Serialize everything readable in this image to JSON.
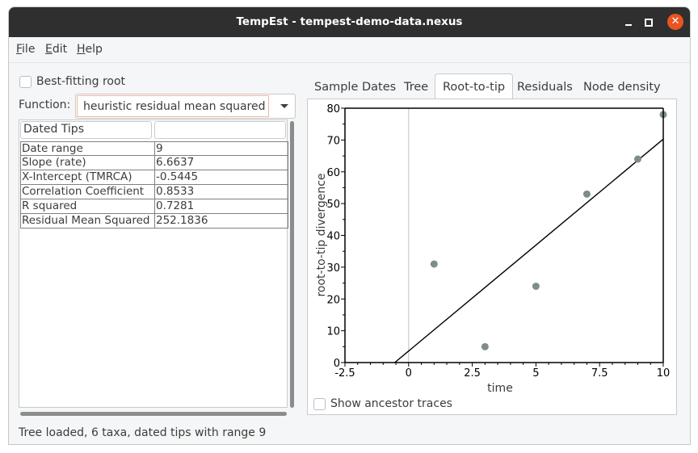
{
  "window": {
    "title": "TempEst - tempest-demo-data.nexus",
    "controls": {
      "minimize_icon": "minimize-icon",
      "maximize_icon": "maximize-icon",
      "close_icon": "close-icon",
      "close_glyph": "✕"
    }
  },
  "menubar": {
    "items": [
      {
        "label": "File",
        "mnemonic": "F",
        "rest": "ile"
      },
      {
        "label": "Edit",
        "mnemonic": "E",
        "rest": "dit"
      },
      {
        "label": "Help",
        "mnemonic": "H",
        "rest": "elp"
      }
    ]
  },
  "left_panel": {
    "best_fitting_root": {
      "label": "Best-fitting root",
      "checked": false
    },
    "function": {
      "label": "Function:",
      "value": "heuristic residual mean squared"
    },
    "table": {
      "headers": [
        "Dated Tips",
        ""
      ],
      "rows": [
        [
          "Date range",
          "9"
        ],
        [
          "Slope (rate)",
          "6.6637"
        ],
        [
          "X-Intercept (TMRCA)",
          "-0.5445"
        ],
        [
          "Correlation Coefficient",
          "0.8533"
        ],
        [
          "R squared",
          "0.7281"
        ],
        [
          "Residual Mean Squared",
          "252.1836"
        ]
      ]
    }
  },
  "status": "Tree loaded, 6 taxa, dated tips with range 9",
  "tabs": [
    {
      "label": "Sample Dates",
      "active": false
    },
    {
      "label": "Tree",
      "active": false
    },
    {
      "label": "Root-to-tip",
      "active": true
    },
    {
      "label": "Residuals",
      "active": false
    },
    {
      "label": "Node density",
      "active": false
    }
  ],
  "show_ancestor_traces": {
    "label": "Show ancestor traces",
    "checked": false
  },
  "chart_data": {
    "type": "scatter",
    "title": "",
    "xlabel": "time",
    "ylabel": "root-to-tip divergence",
    "xlim": [
      -2.5,
      10
    ],
    "ylim": [
      0,
      80
    ],
    "xticks": [
      -2.5,
      0,
      2.5,
      5,
      7.5,
      10
    ],
    "xtick_labels": [
      "-2.5",
      "0",
      "2.5",
      "5",
      "7.5",
      "10"
    ],
    "yticks": [
      0,
      10,
      20,
      30,
      40,
      50,
      60,
      70,
      80
    ],
    "ytick_labels": [
      "0",
      "10",
      "20",
      "30",
      "40",
      "50",
      "60",
      "70",
      "80"
    ],
    "grid": false,
    "reference_line_x": 0,
    "points": [
      {
        "x": 1,
        "y": 31
      },
      {
        "x": 3,
        "y": 5
      },
      {
        "x": 5,
        "y": 24
      },
      {
        "x": 7,
        "y": 53
      },
      {
        "x": 9,
        "y": 64
      },
      {
        "x": 10,
        "y": 78
      }
    ],
    "regression": {
      "slope": 6.6637,
      "x_intercept": -0.5445
    },
    "colors": {
      "point": "#7f8c8d",
      "line": "#000000",
      "reference": "#c0c0c0",
      "axis": "#000000"
    }
  }
}
